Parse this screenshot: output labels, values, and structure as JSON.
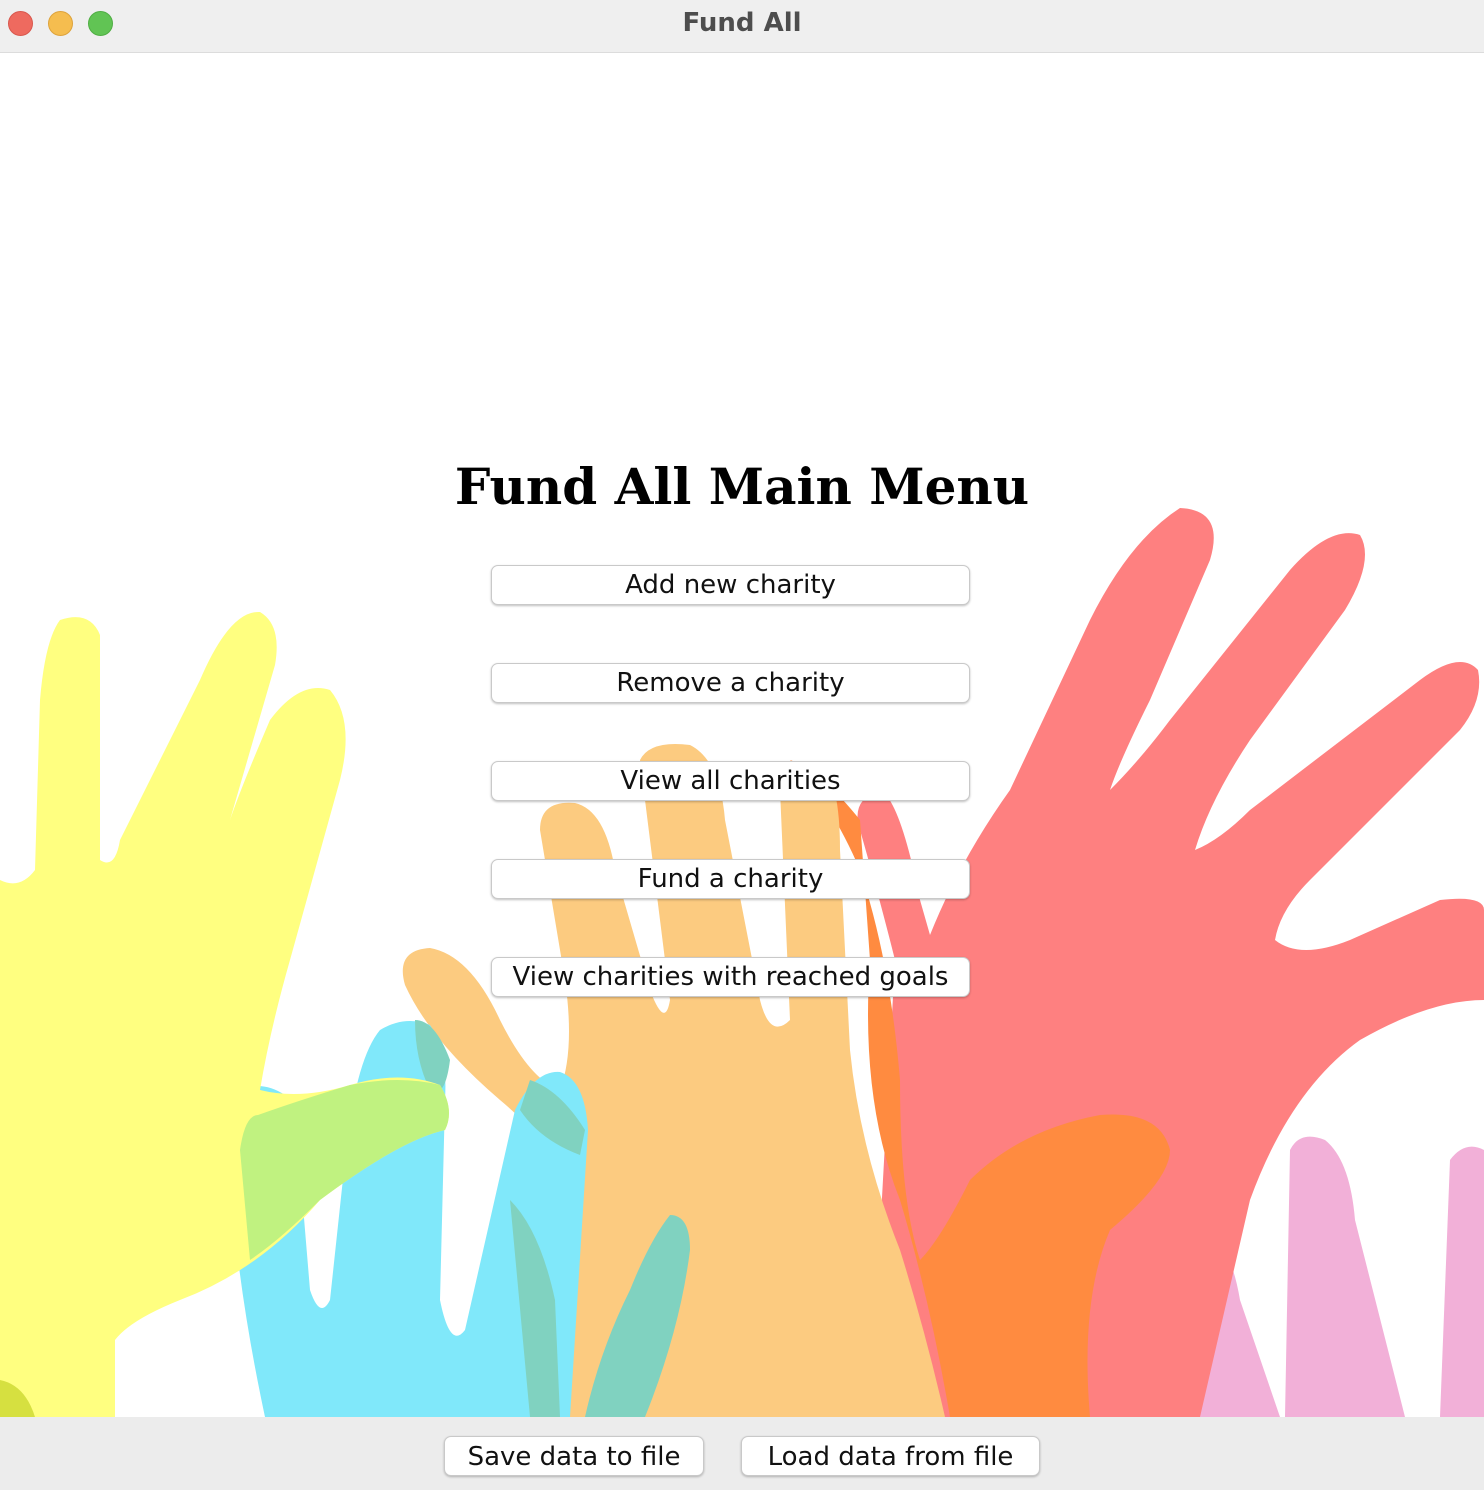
{
  "window": {
    "title": "Fund All"
  },
  "main": {
    "title": "Fund All Main Menu",
    "buttons": [
      {
        "label": "Add new charity"
      },
      {
        "label": "Remove a charity"
      },
      {
        "label": "View all charities"
      },
      {
        "label": "Fund a charity"
      },
      {
        "label": "View charities with reached goals"
      }
    ]
  },
  "footer": {
    "save_label": "Save data to file",
    "load_label": "Load data from file"
  },
  "background": {
    "image": "raised-hands-illustration",
    "colors": [
      "#ffff80",
      "#80e8fa",
      "#fccb80",
      "#fe8080",
      "#ff8b40",
      "#f2b0d8"
    ]
  }
}
